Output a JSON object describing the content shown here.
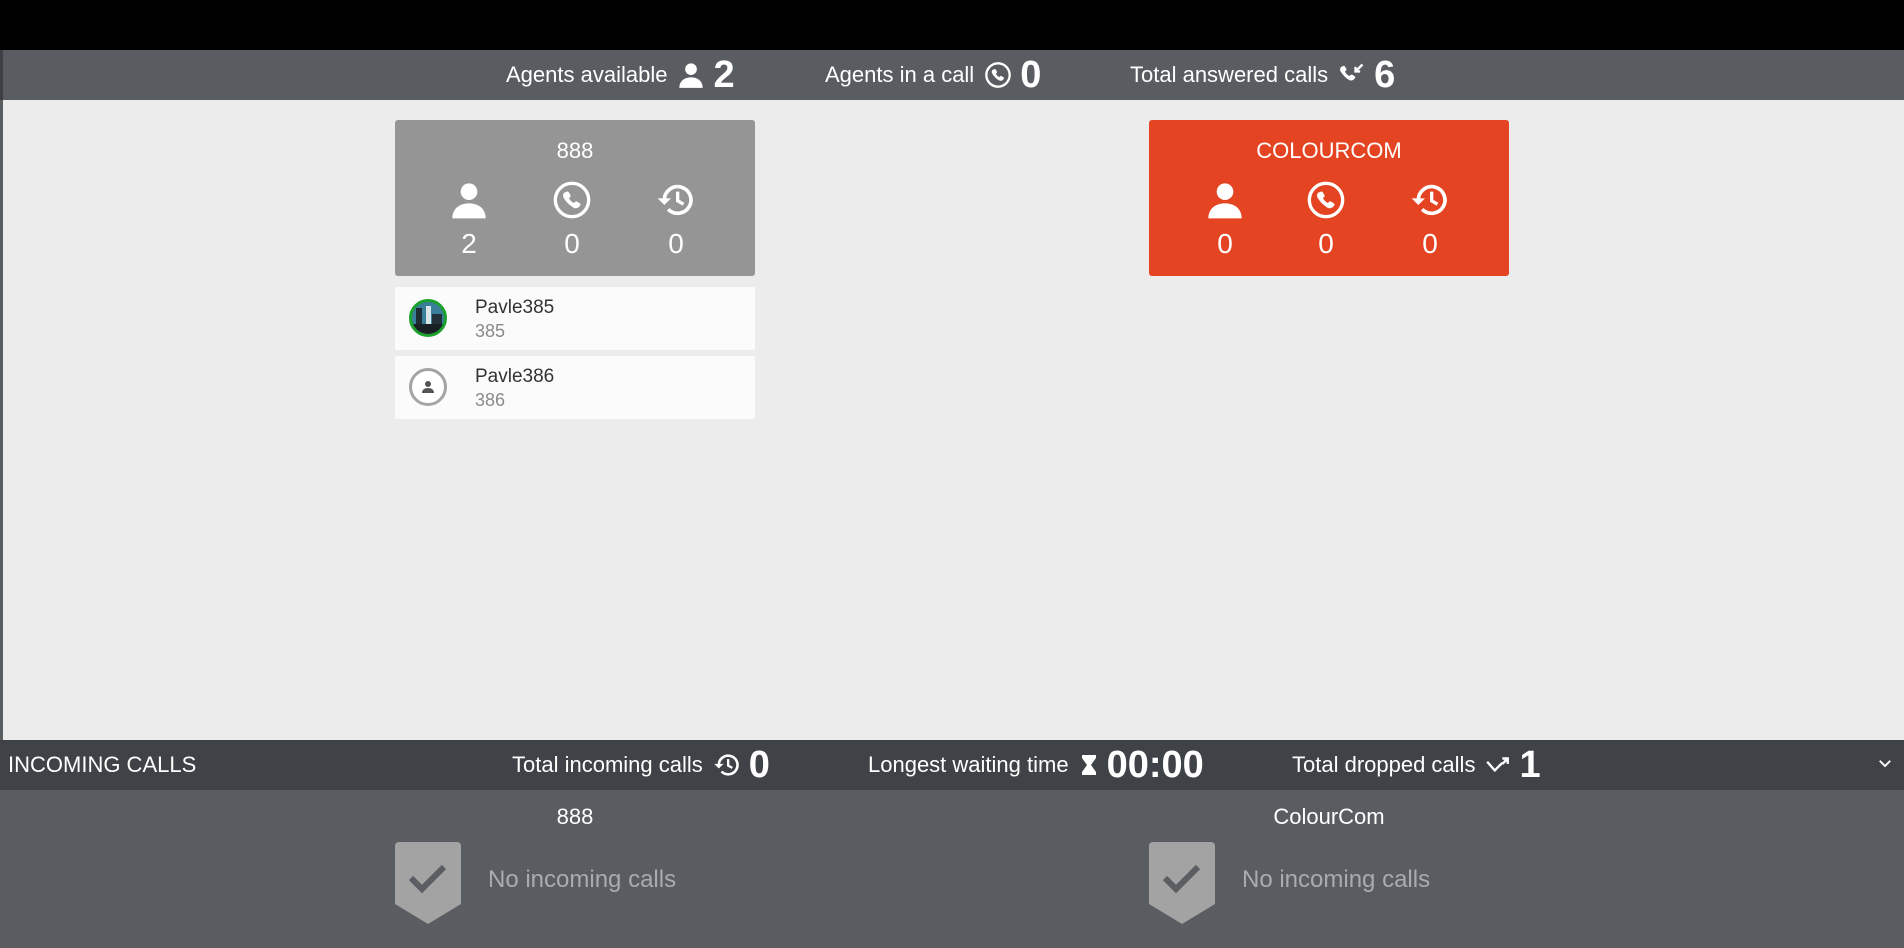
{
  "header": {
    "agents_available_label": "Agents available",
    "agents_available_value": "2",
    "agents_in_call_label": "Agents in a call",
    "agents_in_call_value": "0",
    "total_answered_label": "Total answered calls",
    "total_answered_value": "6"
  },
  "queues": [
    {
      "name": "888",
      "color": "#959595",
      "agents": "2",
      "in_call": "0",
      "waiting": "0",
      "members": [
        {
          "name": "Pavle385",
          "ext": "385",
          "status": "available"
        },
        {
          "name": "Pavle386",
          "ext": "386",
          "status": "offline"
        }
      ]
    },
    {
      "name": "COLOURCOM",
      "color": "#e44421",
      "agents": "0",
      "in_call": "0",
      "waiting": "0",
      "members": []
    }
  ],
  "incoming": {
    "section_title": "INCOMING CALLS",
    "total_incoming_label": "Total incoming calls",
    "total_incoming_value": "0",
    "longest_wait_label": "Longest waiting time",
    "longest_wait_value": "00:00",
    "total_dropped_label": "Total dropped calls",
    "total_dropped_value": "1",
    "queues": [
      {
        "name": "888",
        "empty_text": "No incoming calls"
      },
      {
        "name": "ColourCom",
        "empty_text": "No incoming calls"
      }
    ]
  },
  "icons": {
    "agent": "person-icon",
    "call": "phone-circle-icon",
    "history": "history-icon",
    "answered": "incoming-call-icon",
    "hourglass": "hourglass-icon",
    "dropped": "missed-call-icon",
    "collapse": "chevron-down-icon",
    "empty": "check-shield-icon"
  },
  "colors": {
    "bar_dark": "#3f4246",
    "bar_mid": "#595c61",
    "background": "#ececec",
    "accent_red": "#e44421",
    "neutral_gray": "#959595",
    "available_green": "#1aa12a"
  }
}
